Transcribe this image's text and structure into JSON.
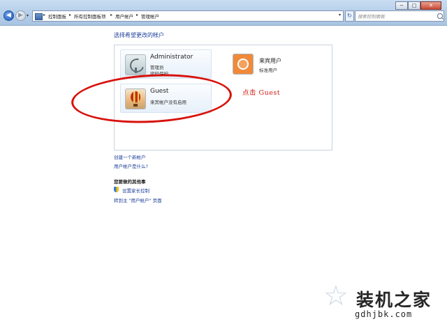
{
  "window": {
    "minimize_label": "−",
    "maximize_label": "□",
    "close_label": "✕"
  },
  "nav": {
    "back_label": "◀",
    "forward_label": "▶",
    "dropdown_label": "▾",
    "refresh_label": "↻"
  },
  "breadcrumb": {
    "items": [
      "控制面板",
      "所有控制面板项",
      "用户帐户",
      "管理帐户"
    ],
    "separator": "▸"
  },
  "search": {
    "placeholder": "搜索控制面板"
  },
  "page": {
    "title": "选择希望更改的帐户"
  },
  "accounts": [
    {
      "name": "Administrator",
      "role": "管理员",
      "status": "密码保护",
      "icon": "satellite-dish-avatar"
    },
    {
      "name": "来宾用户",
      "role": "标准用户",
      "icon": "orange-flower-avatar"
    },
    {
      "name": "Guest",
      "status": "来宾帐户没有启用",
      "icon": "hot-air-balloon-avatar"
    }
  ],
  "annotation": {
    "text": "点击  Guest",
    "color": "#d01a10"
  },
  "links": {
    "create_account": "创建一个新帐户",
    "what_is_account": "用户帐户是什么?"
  },
  "other_tasks": {
    "heading": "您要做的其他事",
    "parental_controls": "设置家长控制",
    "go_main_page": "转到主 \"用户帐户\" 页面"
  },
  "watermark": {
    "brand": "装机之家",
    "url": "gdhjbk.com"
  }
}
